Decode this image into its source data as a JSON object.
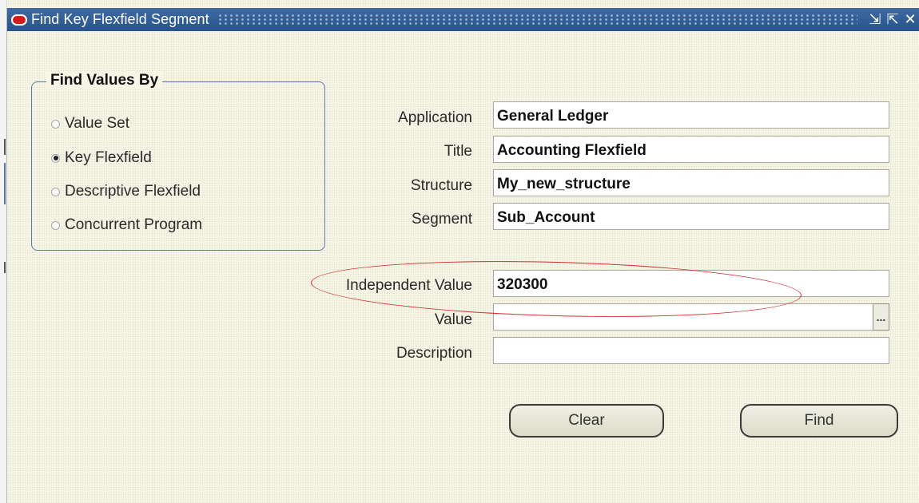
{
  "window": {
    "title": "Find Key Flexfield Segment",
    "buttons": {
      "minimize_glyph": "⇲",
      "maximize_glyph": "⇱",
      "close_glyph": "✕"
    }
  },
  "find_values_by": {
    "title": "Find Values By",
    "options": [
      {
        "label": "Value Set",
        "checked": false
      },
      {
        "label": "Key Flexfield",
        "checked": true
      },
      {
        "label": "Descriptive Flexfield",
        "checked": false
      },
      {
        "label": "Concurrent Program",
        "checked": false
      }
    ]
  },
  "fields": {
    "application": {
      "label": "Application",
      "value": "General Ledger"
    },
    "title": {
      "label": "Title",
      "value": "Accounting Flexfield"
    },
    "structure": {
      "label": "Structure",
      "value": "My_new_structure"
    },
    "segment": {
      "label": "Segment",
      "value": "Sub_Account"
    },
    "independent_value": {
      "label": "Independent Value",
      "value": "320300"
    },
    "value": {
      "label": "Value",
      "value": "",
      "lov_label": "..."
    },
    "description": {
      "label": "Description",
      "value": ""
    }
  },
  "actions": {
    "clear_label": "Clear",
    "find_label": "Find"
  },
  "colors": {
    "title_bar": "#2a5a9a",
    "background": "#f6f5e6",
    "highlight": "#d23030",
    "group_border": "#5c7aa8"
  }
}
